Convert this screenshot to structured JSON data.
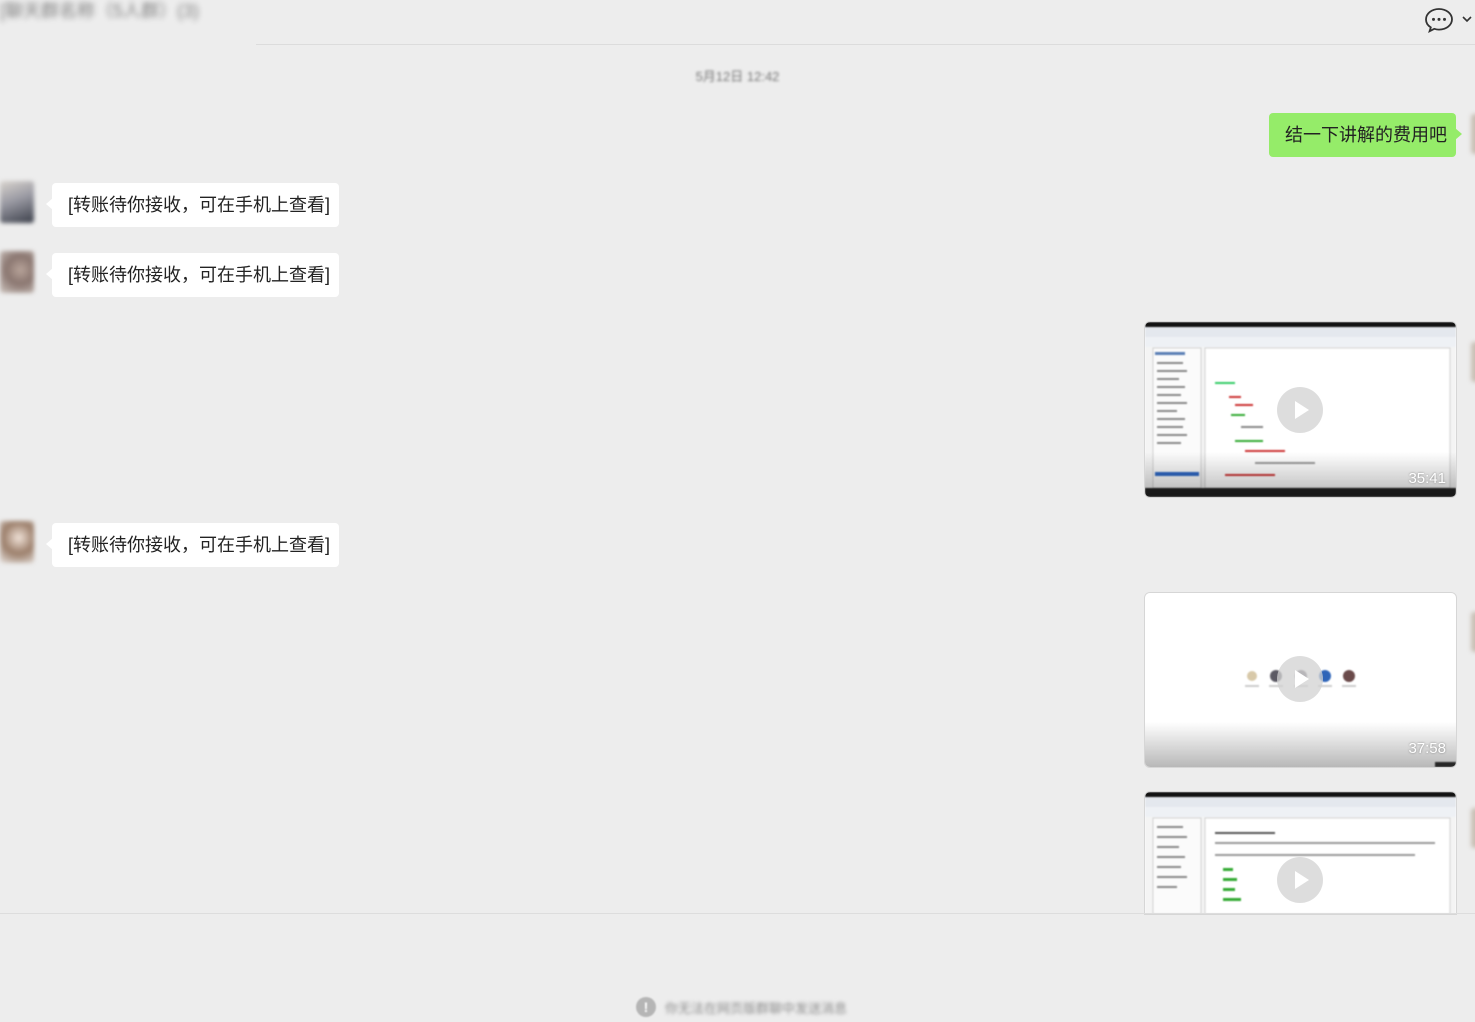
{
  "header": {
    "title": "[聊天群名称（5人群）(3)",
    "chat_icon": "chat-bubble-icon",
    "dropdown_icon": "chevron-down-icon"
  },
  "timestamp": "5月12日 12:42",
  "messages": [
    {
      "type": "text",
      "direction": "sent",
      "text": "结一下讲解的费用吧"
    },
    {
      "type": "text",
      "direction": "received",
      "text": "[转账待你接收，可在手机上查看]"
    },
    {
      "type": "text",
      "direction": "received",
      "text": "[转账待你接收，可在手机上查看]"
    },
    {
      "type": "video",
      "direction": "sent",
      "duration": "35:41"
    },
    {
      "type": "text",
      "direction": "received",
      "text": "[转账待你接收，可在手机上查看]"
    },
    {
      "type": "video",
      "direction": "sent",
      "duration": "37:58"
    },
    {
      "type": "video",
      "direction": "sent",
      "duration": ""
    }
  ],
  "footer": {
    "warning_icon": "exclamation-icon",
    "notice": "你无法在网页版群聊中发送消息"
  },
  "colors": {
    "background": "#ededed",
    "sent_bubble": "#95ec69",
    "received_bubble": "#ffffff"
  }
}
